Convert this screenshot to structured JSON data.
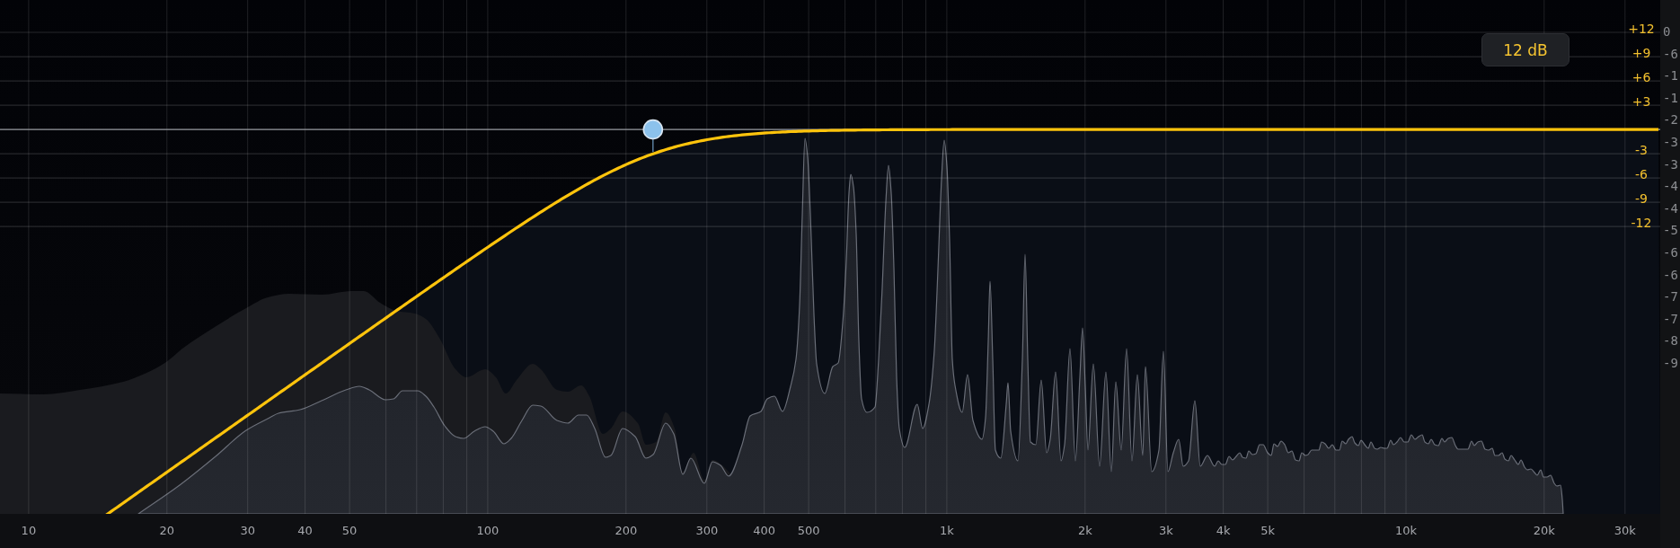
{
  "display": {
    "gain_scale": [
      "+12",
      "+9",
      "+6",
      "+3",
      "-3",
      "-6",
      "-9",
      "-12"
    ],
    "slope_badge": "12 dB"
  },
  "frequency_scale": [
    "10",
    "20",
    "30",
    "40",
    "50",
    "100",
    "200",
    "300",
    "400",
    "500",
    "1k",
    "2k",
    "3k",
    "4k",
    "5k",
    "10k",
    "20k",
    "30k"
  ],
  "level_scale": [
    "0",
    "-6",
    "-1",
    "-1",
    "-2",
    "-3",
    "-3",
    "-4",
    "-4",
    "-5",
    "-6",
    "-6",
    "-7",
    "-7",
    "-8",
    "-9"
  ]
}
